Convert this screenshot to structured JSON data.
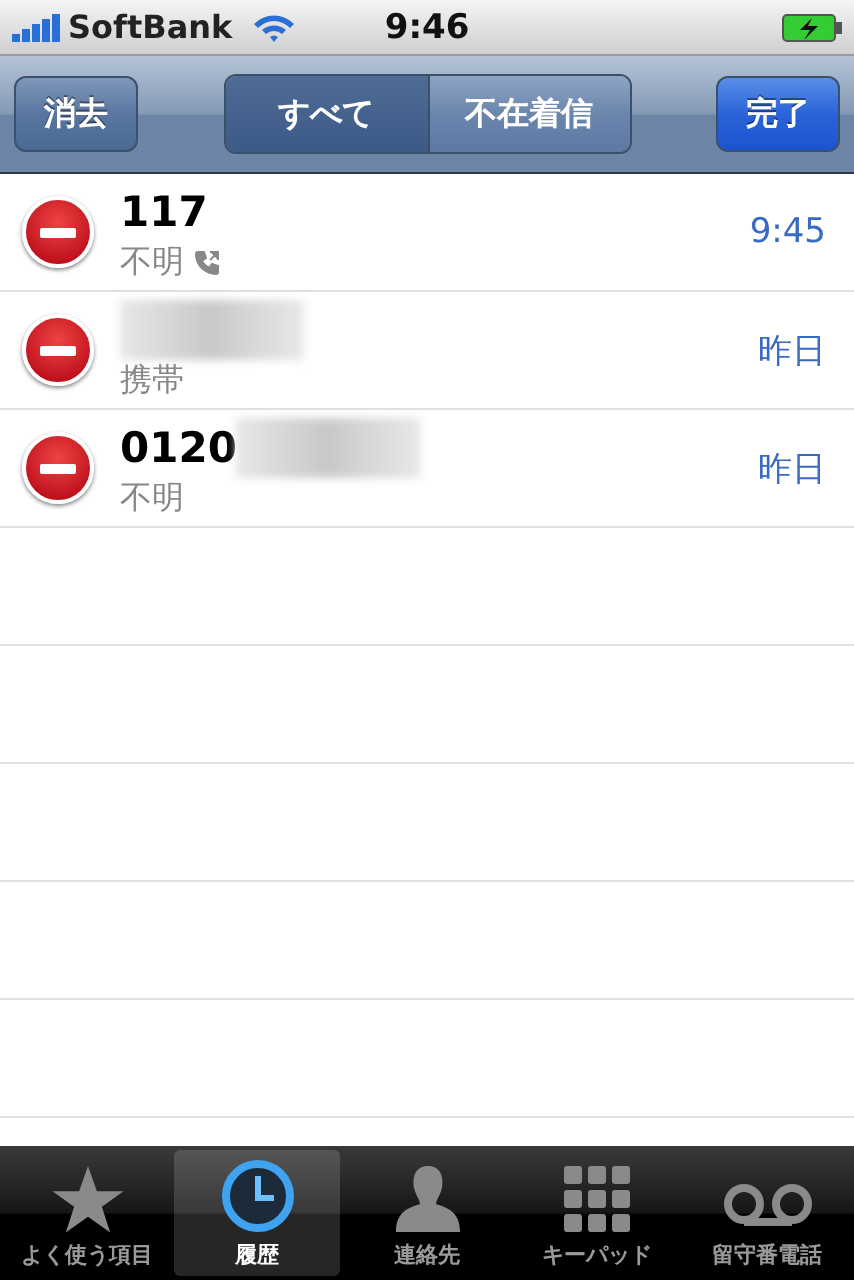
{
  "status_bar": {
    "carrier": "SoftBank",
    "time": "9:46"
  },
  "nav_bar": {
    "left_button": "消去",
    "segments": [
      {
        "label": "すべて",
        "selected": true
      },
      {
        "label": "不在着信",
        "selected": false
      }
    ],
    "right_button": "完了"
  },
  "calls": [
    {
      "name": "117",
      "redacted": false,
      "type": "不明",
      "outgoing": true,
      "time": "9:45"
    },
    {
      "redacted": true,
      "type": "携帯",
      "outgoing": false,
      "time": "昨日"
    },
    {
      "name": "0120",
      "redacted": true,
      "type": "不明",
      "outgoing": false,
      "time": "昨日"
    }
  ],
  "tab_bar": [
    {
      "kind": "star",
      "label": "よく使う項目",
      "selected": false
    },
    {
      "kind": "clock",
      "label": "履歴",
      "selected": true
    },
    {
      "kind": "person",
      "label": "連絡先",
      "selected": false
    },
    {
      "kind": "keypad",
      "label": "キーパッド",
      "selected": false
    },
    {
      "kind": "voicemail",
      "label": "留守番電話",
      "selected": false
    }
  ]
}
